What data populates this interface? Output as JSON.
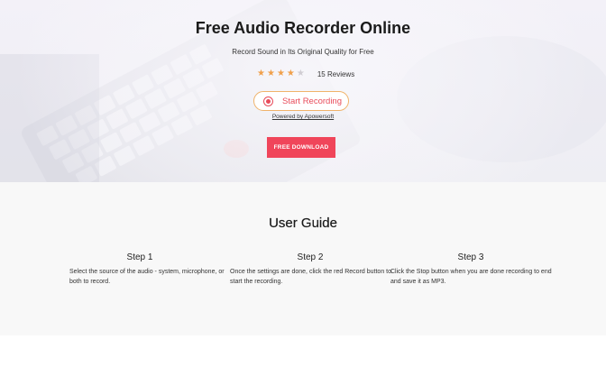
{
  "hero": {
    "title": "Free Audio Recorder Online",
    "subtitle": "Record Sound in Its Original Quality for Free",
    "rating": {
      "stars_filled": 4,
      "stars_total": 5,
      "reviews_label": "15 Reviews"
    },
    "record_button_label": "Start Recording",
    "powered_by": "Powered by Apowersoft",
    "download_button_label": "FREE DOWNLOAD"
  },
  "guide": {
    "title": "User Guide",
    "steps": [
      {
        "title": "Step 1",
        "description": "Select the source of the audio - system, microphone, or both to record."
      },
      {
        "title": "Step 2",
        "description": "Once the settings are done, click the red Record button to start the recording."
      },
      {
        "title": "Step 3",
        "description": "Click the Stop button when you are done recording to end and save it as MP3."
      }
    ]
  },
  "colors": {
    "accent_red": "#f0455a",
    "record_red": "#e84b5a",
    "star_orange": "#f0a04b",
    "record_border": "#f0b36a"
  }
}
